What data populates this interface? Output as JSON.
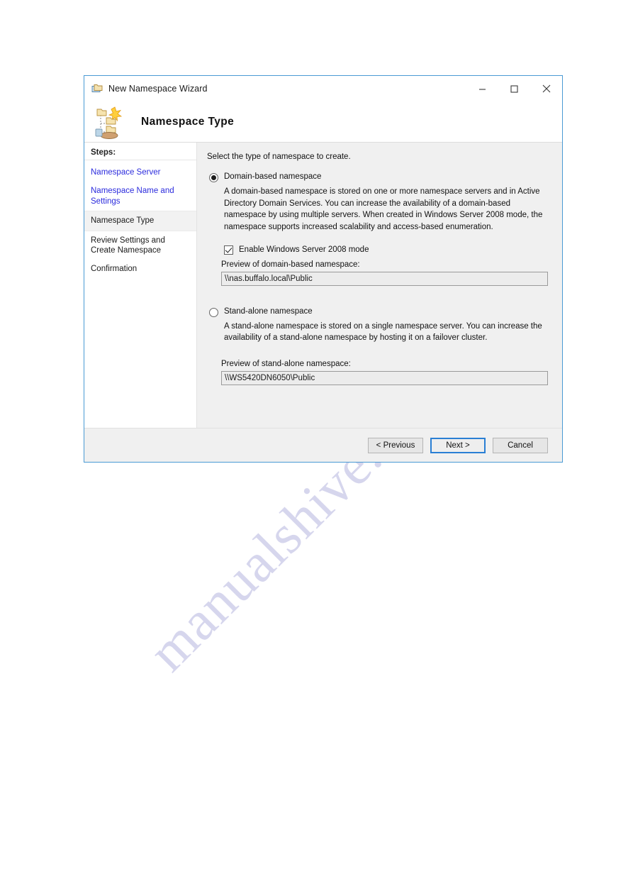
{
  "watermark": {
    "text": "manualshive.com"
  },
  "window": {
    "title": "New Namespace Wizard",
    "title_icon": "namespace-wizard-icon",
    "controls": {
      "minimize": "minimize-icon",
      "maximize": "maximize-icon",
      "close": "close-icon"
    }
  },
  "header": {
    "title": "Namespace Type",
    "icon": "dfs-namespace-tree-icon"
  },
  "sidebar": {
    "heading": "Steps:",
    "items": [
      {
        "label": "Namespace Server",
        "state": "link"
      },
      {
        "label": "Namespace Name and Settings",
        "state": "link"
      },
      {
        "label": "Namespace Type",
        "state": "current"
      },
      {
        "label": "Review Settings and Create Namespace",
        "state": "pending"
      },
      {
        "label": "Confirmation",
        "state": "pending"
      }
    ]
  },
  "content": {
    "intro": "Select the type of namespace to create.",
    "domain_option": {
      "label": "Domain-based namespace",
      "selected": true,
      "description": "A domain-based namespace is stored on one or more namespace servers and in Active Directory Domain Services. You can increase the availability of a domain-based namespace by using multiple servers. When created in Windows Server 2008 mode, the namespace supports increased scalability and access-based enumeration.",
      "checkbox_label": "Enable Windows Server 2008 mode",
      "checkbox_checked": true,
      "preview_label": "Preview of domain-based namespace:",
      "preview_value": "\\\\nas.buffalo.local\\Public"
    },
    "standalone_option": {
      "label": "Stand-alone namespace",
      "selected": false,
      "description": "A stand-alone namespace is stored on a single namespace server. You can increase the availability of a stand-alone namespace by hosting it on a failover cluster.",
      "preview_label": "Preview of stand-alone namespace:",
      "preview_value": "\\\\WS5420DN6050\\Public"
    }
  },
  "footer": {
    "previous": "< Previous",
    "next": "Next >",
    "cancel": "Cancel"
  },
  "colors": {
    "window_border": "#4a9ad4",
    "link": "#2b2bdd",
    "content_bg": "#f0f0f0",
    "focus_border": "#2a7fd4"
  }
}
